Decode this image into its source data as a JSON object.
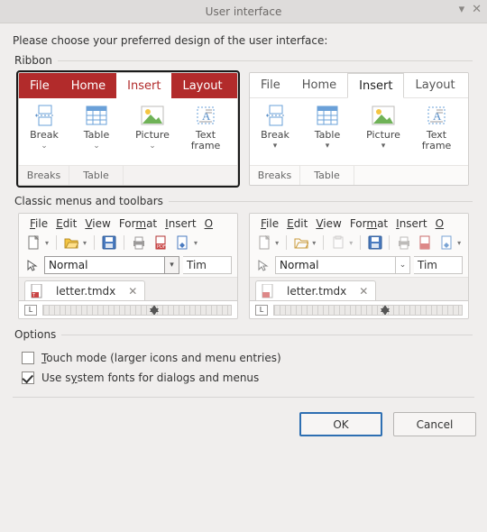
{
  "window": {
    "title": "User interface"
  },
  "intro": "Please choose your preferred design of the user interface:",
  "groups": {
    "ribbon_legend": "Ribbon",
    "classic_legend": "Classic menus and toolbars",
    "options_legend": "Options"
  },
  "ribbon": {
    "tabs": [
      "File",
      "Home",
      "Insert",
      "Layout"
    ],
    "active_index": 2,
    "items": [
      {
        "label": "Break",
        "icon": "page-break-icon"
      },
      {
        "label": "Table",
        "icon": "table-icon"
      },
      {
        "label": "Picture",
        "icon": "picture-icon"
      },
      {
        "label": "Text frame",
        "icon": "text-frame-icon"
      }
    ],
    "groups": [
      "Breaks",
      "Table"
    ]
  },
  "classic": {
    "menus": [
      "File",
      "Edit",
      "View",
      "Format",
      "Insert",
      "O"
    ],
    "style_value": "Normal",
    "font_value_truncated": "Tim",
    "doc_tab": {
      "filename": "letter.tmdx"
    },
    "ruler_corner": "L"
  },
  "options": {
    "touch_mode": {
      "label_prefix": "T",
      "label_rest": "ouch mode (larger icons and menu entries)",
      "checked": false
    },
    "system_fonts": {
      "label_prefix": "Use s",
      "label_under": "y",
      "label_rest": "stem fonts for dialogs and menus",
      "checked": true
    }
  },
  "buttons": {
    "ok": "OK",
    "cancel": "Cancel"
  }
}
